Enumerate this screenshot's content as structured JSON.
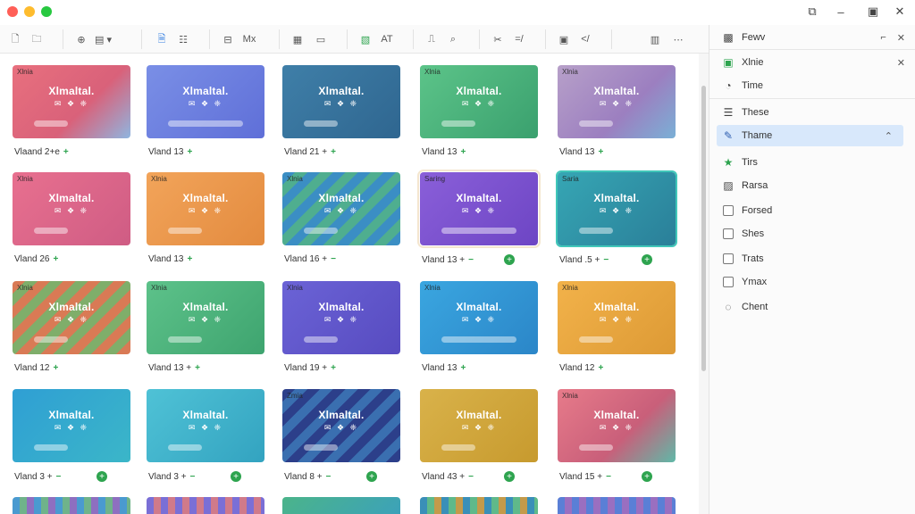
{
  "toolbar": {
    "right_label_1": "Mx",
    "right_label_2": "AT",
    "right_label_3": "=/",
    "right_label_4": "</"
  },
  "tiles": [
    {
      "tag": "Xlnia",
      "title": "Xlmaltal.",
      "caption": "Vlaand 2+e",
      "plus": "+",
      "dot": false
    },
    {
      "tag": "",
      "title": "Xlmaltal.",
      "caption": "Vland 13",
      "plus": "+",
      "dot": false
    },
    {
      "tag": "",
      "title": "Xlmaltal.",
      "caption": "Vland 21 +",
      "plus": "+",
      "dot": false
    },
    {
      "tag": "Xlnia",
      "title": "Xlmaltal.",
      "caption": "Vland 13",
      "plus": "+",
      "dot": false
    },
    {
      "tag": "Xlnia",
      "title": "Xlmaltal.",
      "caption": "Vland 13",
      "plus": "+",
      "dot": false
    },
    {
      "tag": "Xlnia",
      "title": "Xlmaltal.",
      "caption": "Vland 26",
      "plus": "+",
      "dot": false
    },
    {
      "tag": "Xlnia",
      "title": "Xlmaltal.",
      "caption": "Vland 13",
      "plus": "+",
      "dot": false
    },
    {
      "tag": "Xlnia",
      "title": "Xlmaltal.",
      "caption": "Vland 16 +",
      "plus": "−",
      "dot": false
    },
    {
      "tag": "Saring",
      "title": "Xlmaltal.",
      "caption": "Vland 13 +",
      "plus": "−",
      "dot": true
    },
    {
      "tag": "Saria",
      "title": "Xlmaltal.",
      "caption": "Vland .5 +",
      "plus": "−",
      "dot": true
    },
    {
      "tag": "Xlnia",
      "title": "Xlmaltal.",
      "caption": "Vland 12",
      "plus": "+",
      "dot": false
    },
    {
      "tag": "Xlnia",
      "title": "Xlmaltal.",
      "caption": "Vland 13 +",
      "plus": "+",
      "dot": false
    },
    {
      "tag": "Xlnia",
      "title": "Xlmaltal.",
      "caption": "Vland 19 +",
      "plus": "+",
      "dot": false
    },
    {
      "tag": "Xlnia",
      "title": "Xlmaltal.",
      "caption": "Vland 13",
      "plus": "+",
      "dot": false
    },
    {
      "tag": "Xlnia",
      "title": "Xlmaltal.",
      "caption": "Vland 12",
      "plus": "+",
      "dot": false
    },
    {
      "tag": "",
      "title": "Xlmaltal.",
      "caption": "Vland 3 +",
      "plus": "−",
      "dot": true
    },
    {
      "tag": "",
      "title": "Xlmaltal.",
      "caption": "Vland 3 +",
      "plus": "−",
      "dot": true
    },
    {
      "tag": "Zmia",
      "title": "Xlmaltal.",
      "caption": "Vland 8 +",
      "plus": "−",
      "dot": true
    },
    {
      "tag": "",
      "title": "Xlmaltal.",
      "caption": "Vland 43 +",
      "plus": "−",
      "dot": true
    },
    {
      "tag": "Xlnia",
      "title": "Xlmaltal.",
      "caption": "Vland 15 +",
      "plus": "−",
      "dot": true
    }
  ],
  "tile_icons": "✉ ❖ ❈",
  "panel": {
    "header": "Fewv",
    "items": [
      {
        "label": "Xlnie",
        "icon": "square-icon"
      },
      {
        "label": "Time",
        "icon": "clock-icon"
      },
      {
        "label": "These",
        "icon": "list-icon"
      },
      {
        "label": "Thame",
        "icon": "brush-icon",
        "active": true
      },
      {
        "label": "Tirs",
        "icon": "star-icon"
      },
      {
        "label": "Rarsa",
        "icon": "image-icon"
      },
      {
        "label": "Forsed",
        "icon": "checkbox"
      },
      {
        "label": "Shes",
        "icon": "checkbox"
      },
      {
        "label": "Trats",
        "icon": "checkbox"
      },
      {
        "label": "Ymax",
        "icon": "checkbox"
      },
      {
        "label": "Chent",
        "icon": "chat-icon"
      }
    ]
  },
  "colors": {
    "accent": "#d8e8fb",
    "green": "#2ea44f"
  }
}
